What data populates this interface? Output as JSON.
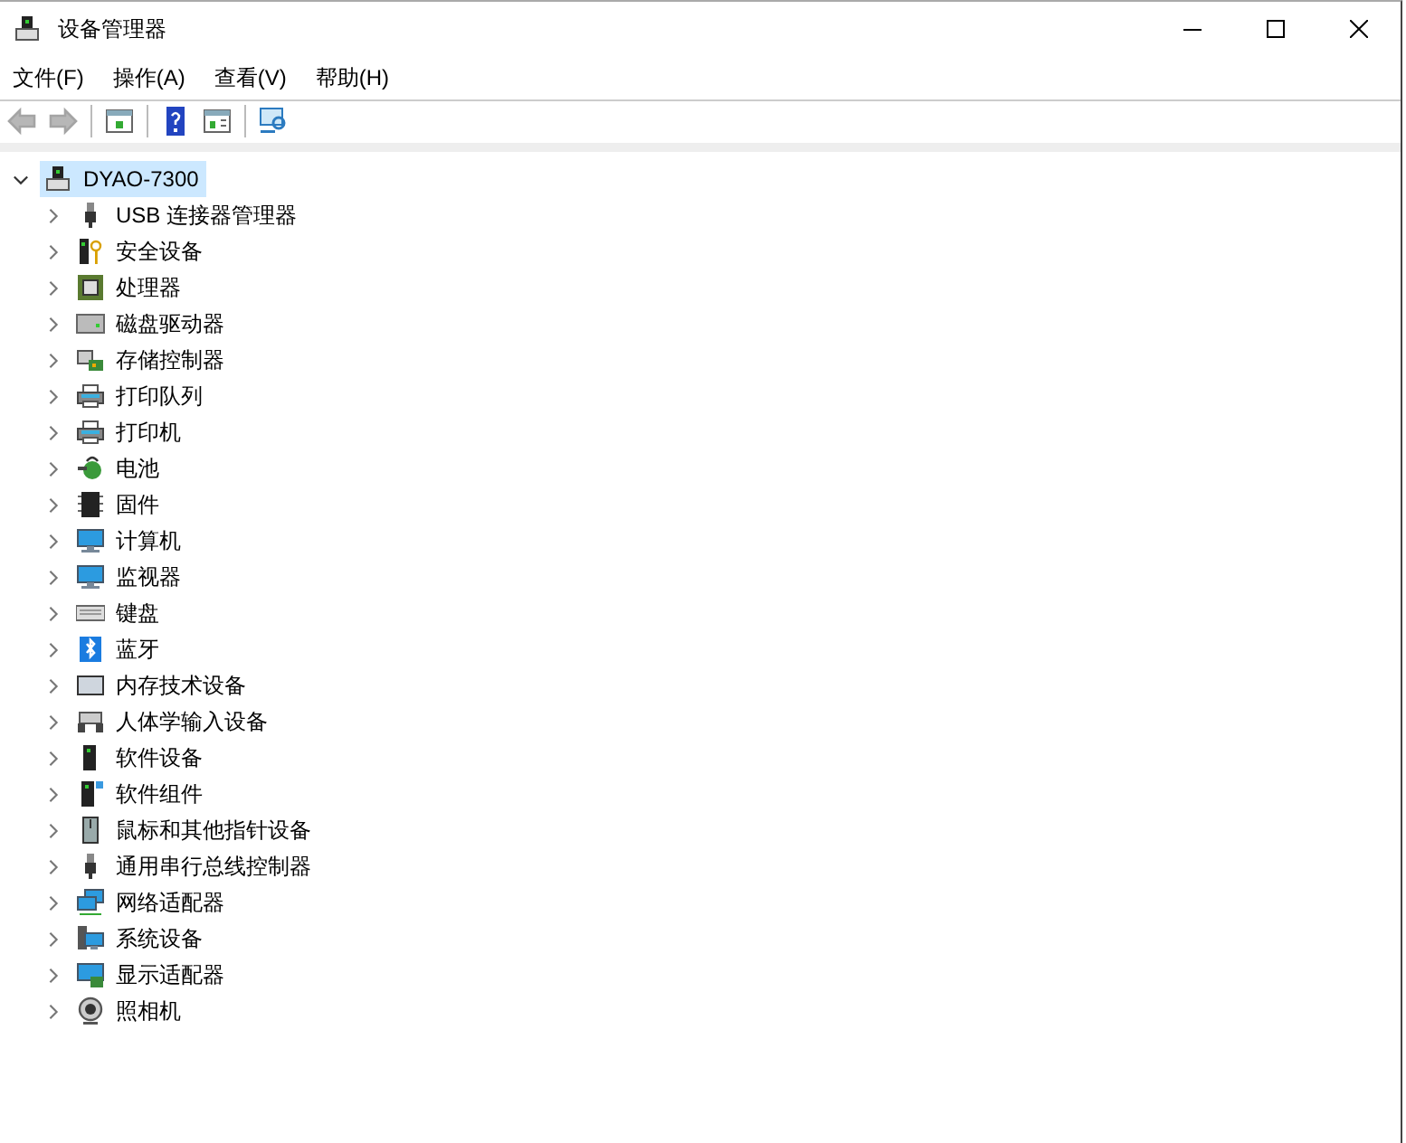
{
  "window": {
    "title": "设备管理器"
  },
  "menu": [
    "文件(F)",
    "操作(A)",
    "查看(V)",
    "帮助(H)"
  ],
  "toolbar": [
    {
      "kind": "back",
      "disabled": true
    },
    {
      "kind": "forward",
      "disabled": true
    },
    {
      "kind": "separator"
    },
    {
      "kind": "console",
      "disabled": false
    },
    {
      "kind": "separator"
    },
    {
      "kind": "help",
      "disabled": false
    },
    {
      "kind": "action",
      "disabled": false
    },
    {
      "kind": "separator"
    },
    {
      "kind": "scan",
      "disabled": false
    }
  ],
  "tree": {
    "label": "DYAO-7300",
    "kind": "pc",
    "expanded": true,
    "selected": true,
    "children": [
      {
        "label": "USB 连接器管理器",
        "kind": "usb",
        "expanded": false,
        "selected": false
      },
      {
        "label": "安全设备",
        "kind": "security",
        "expanded": false,
        "selected": false
      },
      {
        "label": "处理器",
        "kind": "cpu",
        "expanded": false,
        "selected": false
      },
      {
        "label": "磁盘驱动器",
        "kind": "disk",
        "expanded": false,
        "selected": false
      },
      {
        "label": "存储控制器",
        "kind": "storage",
        "expanded": false,
        "selected": false
      },
      {
        "label": "打印队列",
        "kind": "printer",
        "expanded": false,
        "selected": false
      },
      {
        "label": "打印机",
        "kind": "printer",
        "expanded": false,
        "selected": false
      },
      {
        "label": "电池",
        "kind": "battery",
        "expanded": false,
        "selected": false
      },
      {
        "label": "固件",
        "kind": "chip",
        "expanded": false,
        "selected": false
      },
      {
        "label": "计算机",
        "kind": "monitor",
        "expanded": false,
        "selected": false
      },
      {
        "label": "监视器",
        "kind": "monitor",
        "expanded": false,
        "selected": false
      },
      {
        "label": "键盘",
        "kind": "keyboard",
        "expanded": false,
        "selected": false
      },
      {
        "label": "蓝牙",
        "kind": "bluetooth",
        "expanded": false,
        "selected": false
      },
      {
        "label": "内存技术设备",
        "kind": "memory",
        "expanded": false,
        "selected": false
      },
      {
        "label": "人体学输入设备",
        "kind": "hid",
        "expanded": false,
        "selected": false
      },
      {
        "label": "软件设备",
        "kind": "software",
        "expanded": false,
        "selected": false
      },
      {
        "label": "软件组件",
        "kind": "component",
        "expanded": false,
        "selected": false
      },
      {
        "label": "鼠标和其他指针设备",
        "kind": "mouse",
        "expanded": false,
        "selected": false
      },
      {
        "label": "通用串行总线控制器",
        "kind": "usb",
        "expanded": false,
        "selected": false
      },
      {
        "label": "网络适配器",
        "kind": "network",
        "expanded": false,
        "selected": false
      },
      {
        "label": "系统设备",
        "kind": "system",
        "expanded": false,
        "selected": false
      },
      {
        "label": "显示适配器",
        "kind": "display",
        "expanded": false,
        "selected": false
      },
      {
        "label": "照相机",
        "kind": "camera",
        "expanded": false,
        "selected": false
      }
    ]
  }
}
